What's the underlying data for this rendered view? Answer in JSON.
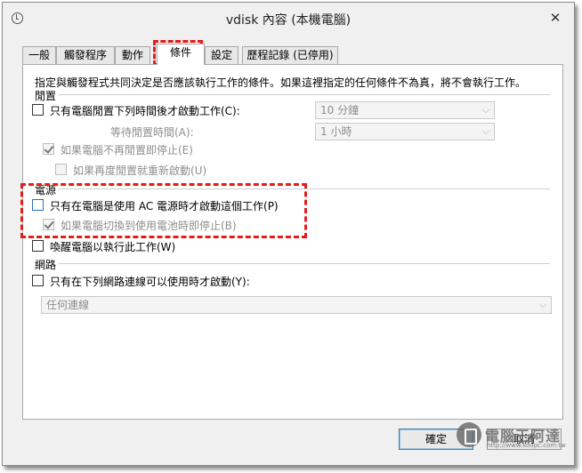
{
  "window": {
    "title": "vdisk 內容 (本機電腦)",
    "close_symbol": "✕"
  },
  "tabs": [
    {
      "label": "一般"
    },
    {
      "label": "觸發程序"
    },
    {
      "label": "動作"
    },
    {
      "label": "條件"
    },
    {
      "label": "設定"
    },
    {
      "label": "歷程記錄 (已停用)"
    }
  ],
  "active_tab": "條件",
  "description": "指定與觸發程式共同決定是否應該執行工作的條件。如果這裡指定的任何條件不為真，將不會執行工作。",
  "idle": {
    "group_label": "閒置",
    "start_if_idle": {
      "label": "只有電腦閒置下列時間後才啟動工作(C):",
      "checked": false,
      "value": "10 分鐘"
    },
    "wait_idle": {
      "label": "等待閒置時間(A):",
      "value": "1 小時"
    },
    "stop_if_not_idle": {
      "label": "如果電腦不再閒置即停止(E)",
      "checked": true
    },
    "restart_if_idle": {
      "label": "如果再度閒置就重新啟動(U)",
      "checked": false
    }
  },
  "power": {
    "group_label": "電源",
    "ac_only": {
      "label": "只有在電腦是使用 AC 電源時才啟動這個工作(P)",
      "checked": false
    },
    "stop_on_battery": {
      "label": "如果電腦切換到使用電池時即停止(B)",
      "checked": true
    },
    "wake": {
      "label": "喚醒電腦以執行此工作(W)",
      "checked": false
    }
  },
  "network": {
    "group_label": "網路",
    "only_if_network": {
      "label": "只有在下列網路連線可以使用時才啟動(Y):",
      "checked": false
    },
    "connection_value": "任何連線"
  },
  "buttons": {
    "ok": "確定",
    "cancel": "取消"
  },
  "watermark": {
    "text": "電腦王阿達",
    "url": "http://www.koopc.com.tw"
  },
  "colors": {
    "highlight": "#e31c1c",
    "default_button_border": "#3c7fb1"
  }
}
